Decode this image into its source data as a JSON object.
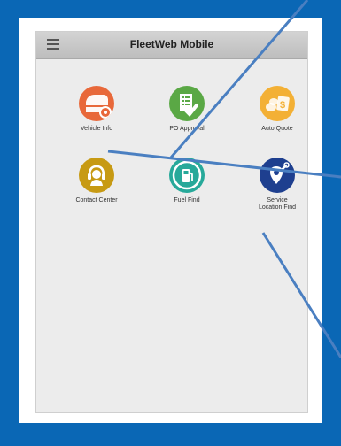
{
  "header": {
    "title": "FleetWeb Mobile",
    "menu_icon": "hamburger-menu-icon"
  },
  "tiles": [
    {
      "label": "Vehicle Info",
      "icon": "vehicle-icon",
      "color": "#e8683a"
    },
    {
      "label": "PO Approval",
      "icon": "po-approval-icon",
      "color": "#5aa845"
    },
    {
      "label": "Auto Quote",
      "icon": "auto-quote-icon",
      "color": "#f3b035"
    },
    {
      "label": "Contact Center",
      "icon": "headset-icon",
      "color": "#c79a13"
    },
    {
      "label": "Fuel Find",
      "icon": "fuel-pump-icon",
      "color": "#27a99a"
    },
    {
      "label_line1": "Service",
      "label_line2": "Location Find",
      "icon": "location-wrench-icon",
      "color": "#1e3f8f"
    }
  ],
  "colors": {
    "frame": "#0a67b5",
    "pointer_lines": "#4a7fc1"
  }
}
